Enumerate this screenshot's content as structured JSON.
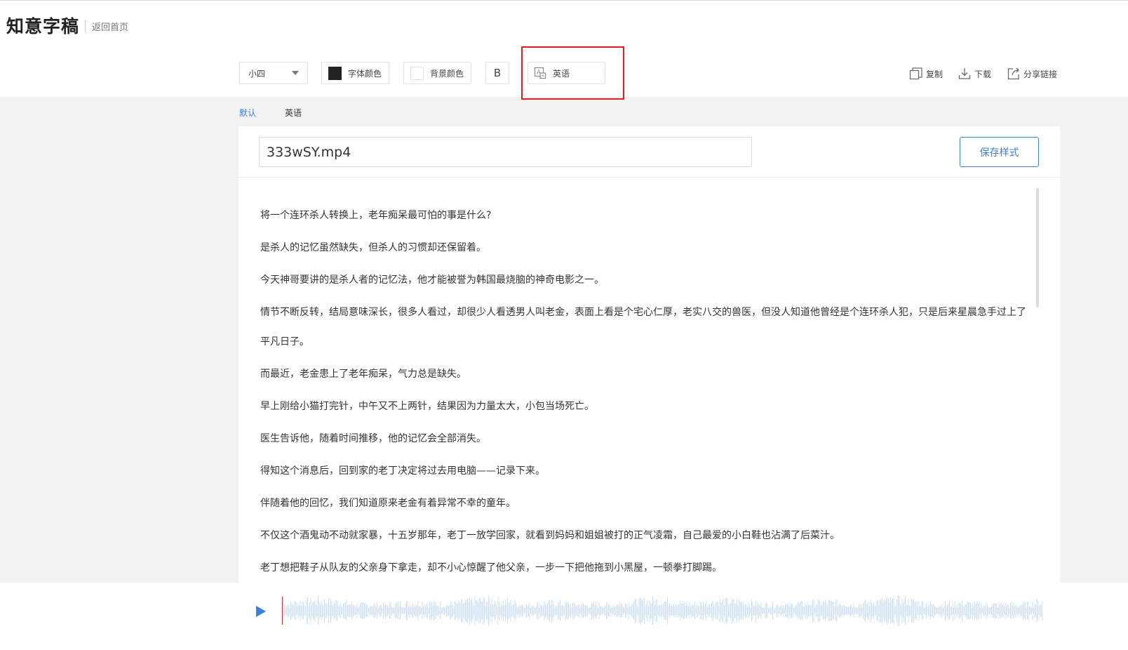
{
  "header": {
    "logo": "知意字稿",
    "back_link": "返回首页"
  },
  "toolbar": {
    "font_size": "小四",
    "font_color_label": "字体颜色",
    "font_color_value": "#222222",
    "bg_color_label": "背景颜色",
    "bg_color_value": "#ffffff",
    "bold_label": "B",
    "language_label": "英语",
    "actions": {
      "copy": "复制",
      "download": "下载",
      "share": "分享链接"
    }
  },
  "tabs": [
    "默认",
    "英语"
  ],
  "editor": {
    "filename": "333wSY.mp4",
    "save_style_label": "保存样式",
    "lines": [
      "将一个连环杀人转换上，老年痴呆最可怕的事是什么?",
      "是杀人的记忆虽然缺失，但杀人的习惯却还保留着。",
      "今天神哥要讲的是杀人者的记忆法，他才能被誉为韩国最烧脑的神奇电影之一。",
      "情节不断反转，结局意味深长，很多人看过，却很少人看透男人叫老金，表面上看是个宅心仁厚，老实八交的兽医，但没人知道他曾经是个连环杀人犯，只是后来星晨急手过上了平凡日子。",
      "而最近，老金患上了老年痴呆，气力总是缺失。",
      "早上刚给小猫打完针，中午又不上两针，结果因为力量太大，小包当场死亡。",
      "医生告诉他，随着时间推移，他的记忆会全部消失。",
      "得知这个消息后，回到家的老丁决定将过去用电脑——记录下来。",
      "伴随着他的回忆，我们知道原来老金有着异常不幸的童年。",
      "不仅这个酒鬼动不动就家暴，十五岁那年，老丁一放学回家，就看到妈妈和姐姐被打的正气凌霜，自己最爱的小白鞋也沾满了后菜汁。",
      "老丁想把鞋子从队友的父亲身下拿走，却不小心惊醒了他父亲，一步一下把他拖到小黑屋，一顿拳打脚踢。"
    ]
  },
  "colors": {
    "accent": "#3b82d6",
    "highlight_border": "#e02020",
    "waveform": "#cfe0ef",
    "playhead": "#e03030"
  }
}
